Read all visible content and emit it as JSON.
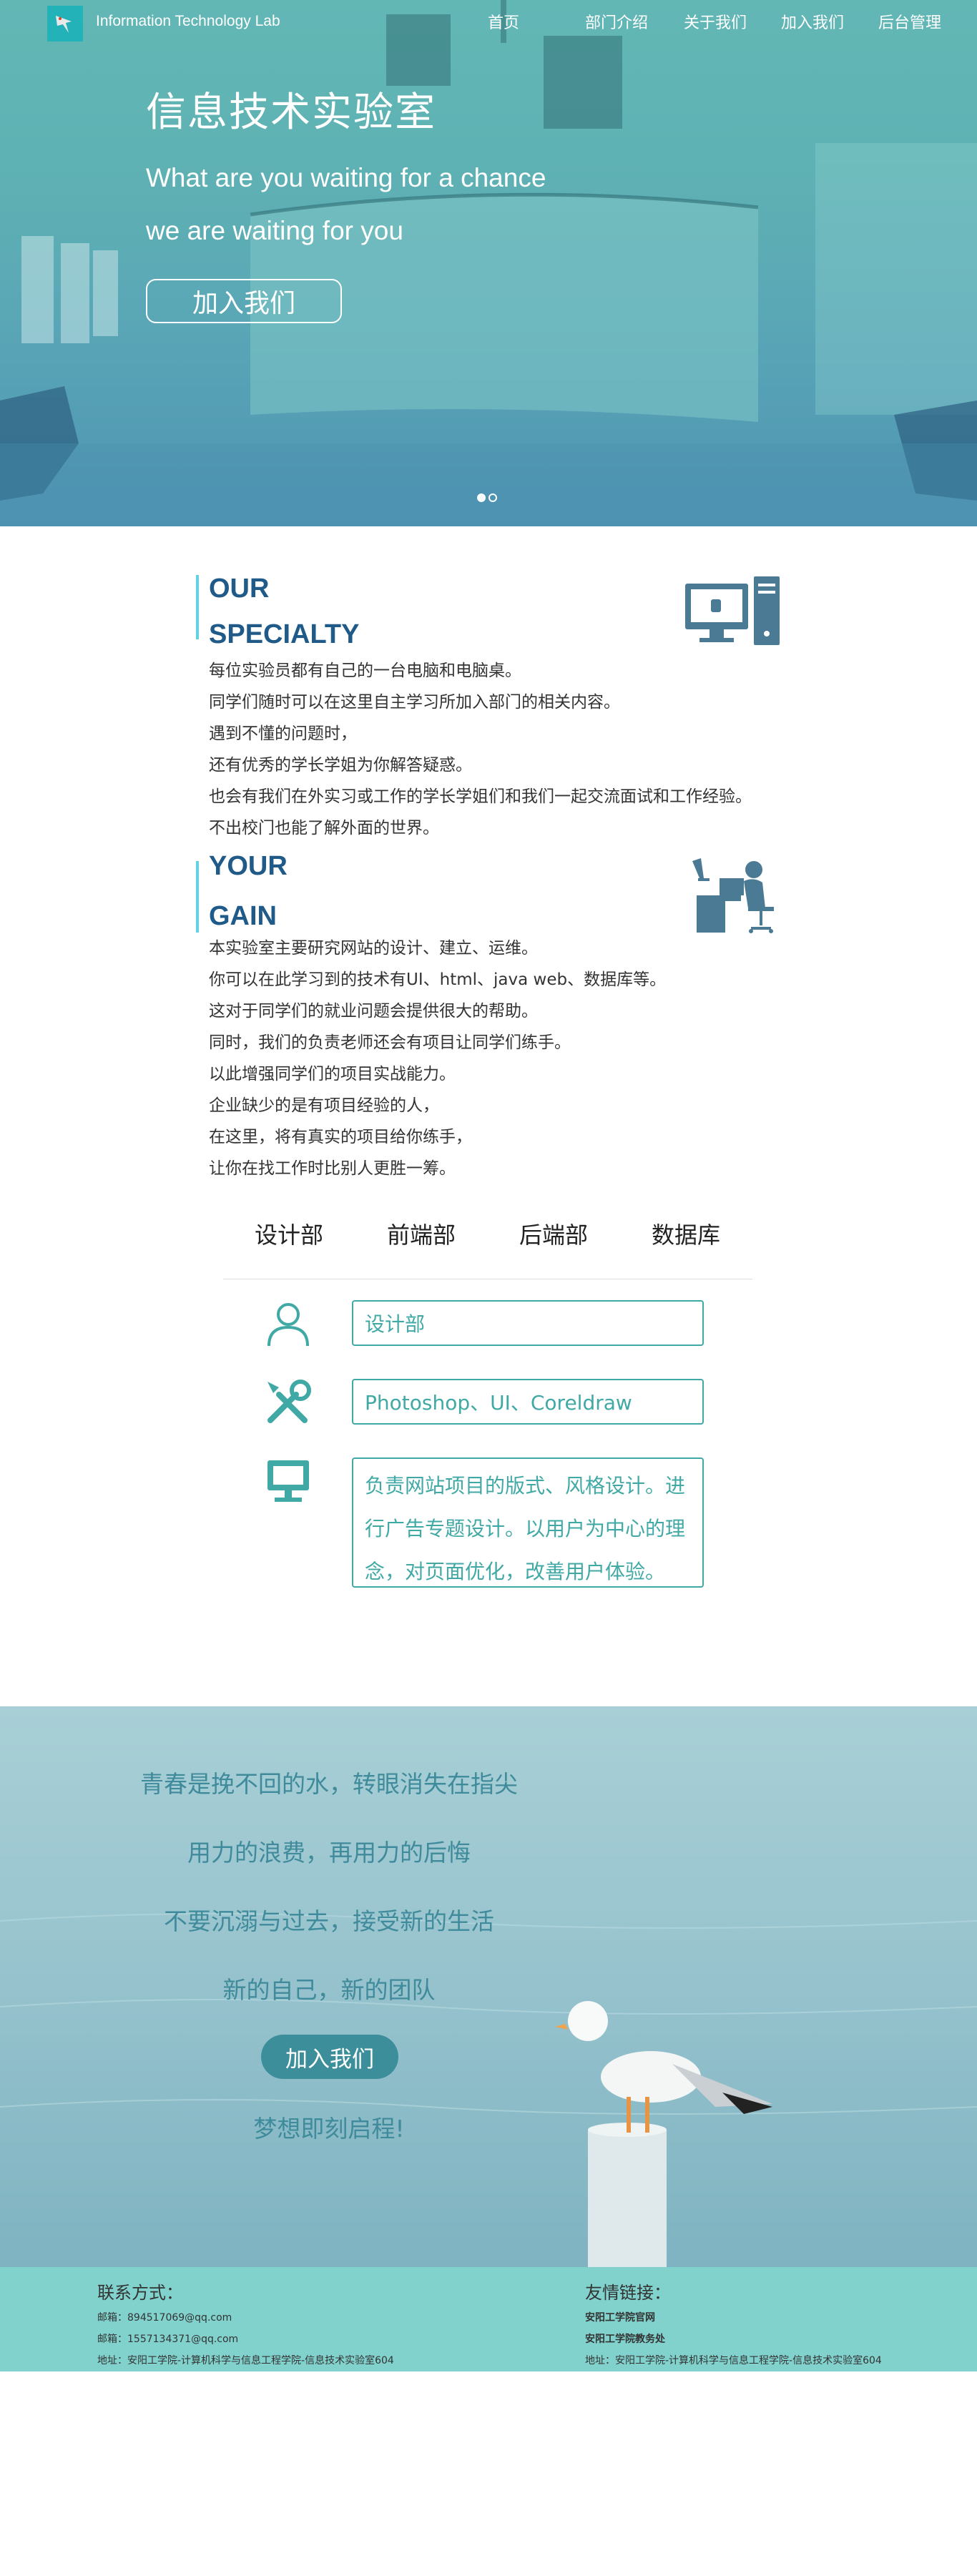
{
  "header": {
    "brand": "Information Technology Lab",
    "nav": [
      "首页",
      "部门介绍",
      "关于我们",
      "加入我们",
      "后台管理"
    ]
  },
  "hero": {
    "title": "信息技术实验室",
    "line1": "What are you waiting for a chance",
    "line2": "we are waiting for you",
    "join_label": "加入我们",
    "slide_count": 2,
    "active_slide": 1
  },
  "specialty": {
    "heading1": "OUR",
    "heading2": "SPECIALTY",
    "lines": [
      "每位实验员都有自己的一台电脑和电脑桌。",
      "同学们随时可以在这里自主学习所加入部门的相关内容。",
      "遇到不懂的问题时，",
      "还有优秀的学长学姐为你解答疑惑。",
      "也会有我们在外实习或工作的学长学姐们和我们一起交流面试和工作经验。",
      "不出校门也能了解外面的世界。"
    ]
  },
  "gain": {
    "heading1": "YOUR",
    "heading2": "GAIN",
    "lines": [
      "本实验室主要研究网站的设计、建立、运维。",
      "你可以在此学习到的技术有UI、html、java web、数据库等。",
      "这对于同学们的就业问题会提供很大的帮助。",
      "同时，我们的负责老师还会有项目让同学们练手。",
      "以此增强同学们的项目实战能力。",
      "企业缺少的是有项目经验的人，",
      "在这里，将有真实的项目给你练手，",
      "让你在找工作时比别人更胜一筹。"
    ]
  },
  "departments": {
    "tabs": [
      "设计部",
      "前端部",
      "后端部",
      "数据库"
    ],
    "name": "设计部",
    "skills": "Photoshop、UI、Coreldraw",
    "description_lines": [
      "负责网站项目的版式、风格设计。进",
      "行广告专题设计。以用户为中心的理",
      "念，对页面优化，改善用户体验。"
    ]
  },
  "slogan": {
    "lines": [
      "青春是挽不回的水，转眼消失在指尖",
      "用力的浪费，再用力的后悔",
      "不要沉溺与过去，接受新的生活",
      "新的自己，新的团队"
    ],
    "join_label": "加入我们",
    "closing": "梦想即刻启程!"
  },
  "footer": {
    "contact_title": "联系方式：",
    "contact_lines": [
      "邮箱：894517069@qq.com",
      "邮箱：1557134371@qq.com",
      "地址：安阳工学院-计算机科学与信息工程学院-信息技术实验室604"
    ],
    "links_title": "友情链接：",
    "links": [
      "安阳工学院官网",
      "安阳工学院教务处",
      "地址：安阳工学院-计算机科学与信息工程学院-信息技术实验室604"
    ]
  },
  "colors": {
    "accent": "#41a9a5",
    "heading": "#1f5a88",
    "footer_bg": "#81d2cd",
    "slogan_text": "#3f8b9b"
  }
}
